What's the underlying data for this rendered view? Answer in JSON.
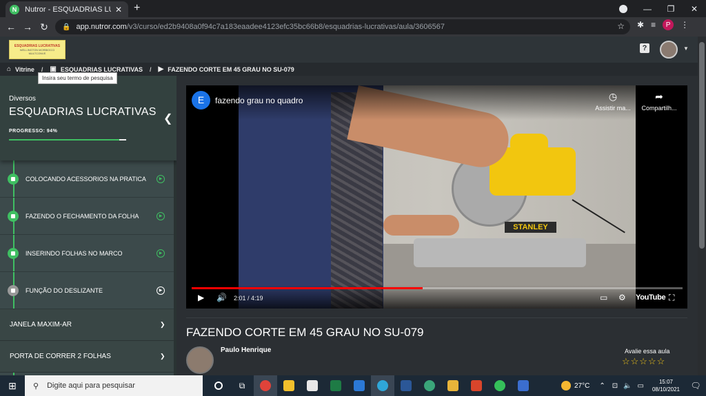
{
  "browser": {
    "tab_title": "Nutror - ESQUADRIAS LUCRATIVAS",
    "tab_favicon_letter": "N",
    "url_host": "app.nutror.com",
    "url_path": "/v3/curso/ed2b9408a0f94c7a183eaadee4123efc35bc66b8/esquadrias-lucrativas/aula/3606567",
    "profile_letter": "P"
  },
  "header": {
    "logo_line1": "ESQUADRIAS LUCRATIVAS",
    "logo_line2": "WELLINGTON MORBIOCCI",
    "logo_line3": "MULTCONVE"
  },
  "breadcrumb": {
    "home": "Vitrine",
    "course": "ESQUADRIAS LUCRATIVAS",
    "lesson": "FAZENDO CORTE EM 45 GRAU NO SU-079",
    "tooltip": "Insira seu termo de pesquisa"
  },
  "sidebar": {
    "category": "Diversos",
    "course_title": "ESQUADRIAS LUCRATIVAS",
    "progress_label": "PROGRESSO: 94%",
    "progress_percent": 94,
    "lessons": [
      {
        "label": "COLOCANDO ACESSORIOS NA PRATICA",
        "completed": true
      },
      {
        "label": "FAZENDO O FECHAMENTO DA FOLHA",
        "completed": true
      },
      {
        "label": "INSERINDO FOLHAS NO MARCO",
        "completed": true
      },
      {
        "label": "FUNÇÃO DO DESLIZANTE",
        "completed": false
      }
    ],
    "modules": [
      {
        "label": "JANELA MAXIM-AR"
      },
      {
        "label": "PORTA DE CORRER 2 FOLHAS"
      }
    ]
  },
  "video": {
    "channel_letter": "E",
    "title": "fazendo grau no quadro",
    "watch_later": "Assistir ma...",
    "share": "Compartilh...",
    "time": "2:01 / 4:19",
    "progress_fraction": 0.47,
    "brand_on_tool": "STANLEY",
    "youtube_label": "YouTube"
  },
  "lesson": {
    "title": "FAZENDO CORTE EM 45 GRAU NO SU-079",
    "author": "Paulo Henrique",
    "rate_label": "Avalie essa aula",
    "stars": "☆☆☆☆☆"
  },
  "taskbar": {
    "search_placeholder": "Digite aqui para pesquisar",
    "temperature": "27°C",
    "time": "15:07",
    "date": "08/10/2021"
  },
  "colors": {
    "accent_green": "#3fbf62",
    "youtube_red": "#ff0000",
    "star_yellow": "#f0c419"
  }
}
